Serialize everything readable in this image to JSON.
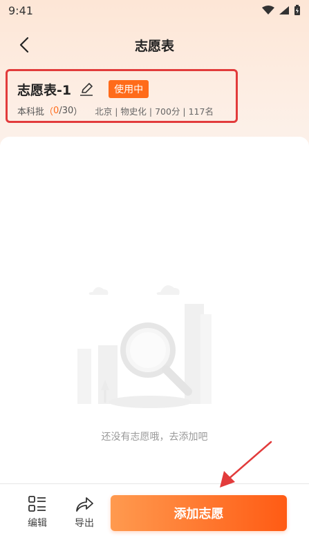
{
  "status_bar": {
    "time": "9:41"
  },
  "nav": {
    "title": "志愿表"
  },
  "card": {
    "title": "志愿表-1",
    "badge": "使用中",
    "batch": "本科批",
    "count_open": "（",
    "count_current": "0",
    "count_sep": "/",
    "count_total": "30",
    "count_close": "）",
    "meta": "北京 | 物史化 | 700分 | 117名"
  },
  "empty_state": {
    "text": "还没有志愿哦，去添加吧"
  },
  "bottom": {
    "edit_label": "编辑",
    "export_label": "导出",
    "add_label": "添加志愿"
  },
  "colors": {
    "accent": "#ff6b1a",
    "highlight_border": "#e23b3b",
    "arrow": "#e23b3b"
  }
}
